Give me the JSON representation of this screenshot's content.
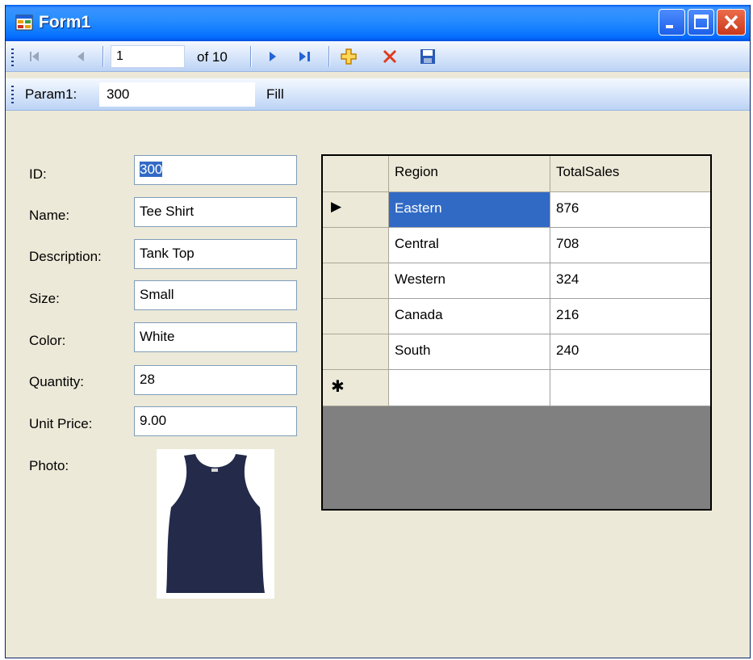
{
  "window": {
    "title": "Form1"
  },
  "navigator": {
    "position": "1",
    "count_label": "of 10",
    "buttons": [
      "move-first",
      "move-previous",
      "move-next",
      "move-last",
      "add-new",
      "delete",
      "save"
    ]
  },
  "param_toolbar": {
    "param_label": "Param1:",
    "param_value": "300",
    "fill_label": "Fill"
  },
  "form": {
    "fields": [
      {
        "label": "ID:",
        "value": "300"
      },
      {
        "label": "Name:",
        "value": "Tee Shirt"
      },
      {
        "label": "Description:",
        "value": "Tank Top"
      },
      {
        "label": "Size:",
        "value": "Small"
      },
      {
        "label": "Color:",
        "value": "White"
      },
      {
        "label": "Quantity:",
        "value": "28"
      },
      {
        "label": "Unit Price:",
        "value": "9.00"
      }
    ],
    "photo_label": "Photo:"
  },
  "grid": {
    "columns": [
      "Region",
      "TotalSales"
    ],
    "rows": [
      [
        "Eastern",
        "876"
      ],
      [
        "Central",
        "708"
      ],
      [
        "Western",
        "324"
      ],
      [
        "Canada",
        "216"
      ],
      [
        "South",
        "240"
      ]
    ],
    "new_row_marker": "✱",
    "current_row_marker": "▶"
  },
  "colors": {
    "selection": "#316ac5",
    "title_bar": "#0058ee",
    "background": "#ece9d8"
  }
}
